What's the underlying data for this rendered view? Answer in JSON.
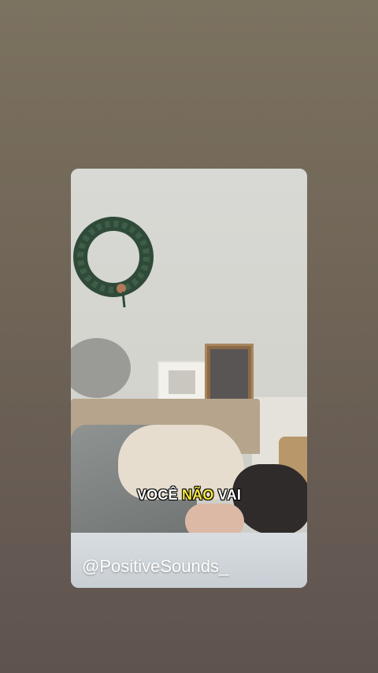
{
  "story": {
    "caption": {
      "part1": "VOCÊ ",
      "highlight": "NÃO",
      "part2": " VAI"
    },
    "handle": "@PositiveSounds_"
  },
  "colors": {
    "background_top": "#7c7260",
    "background_bottom": "#5f5350",
    "caption_text": "#ffffff",
    "caption_highlight": "#f4e53a"
  }
}
